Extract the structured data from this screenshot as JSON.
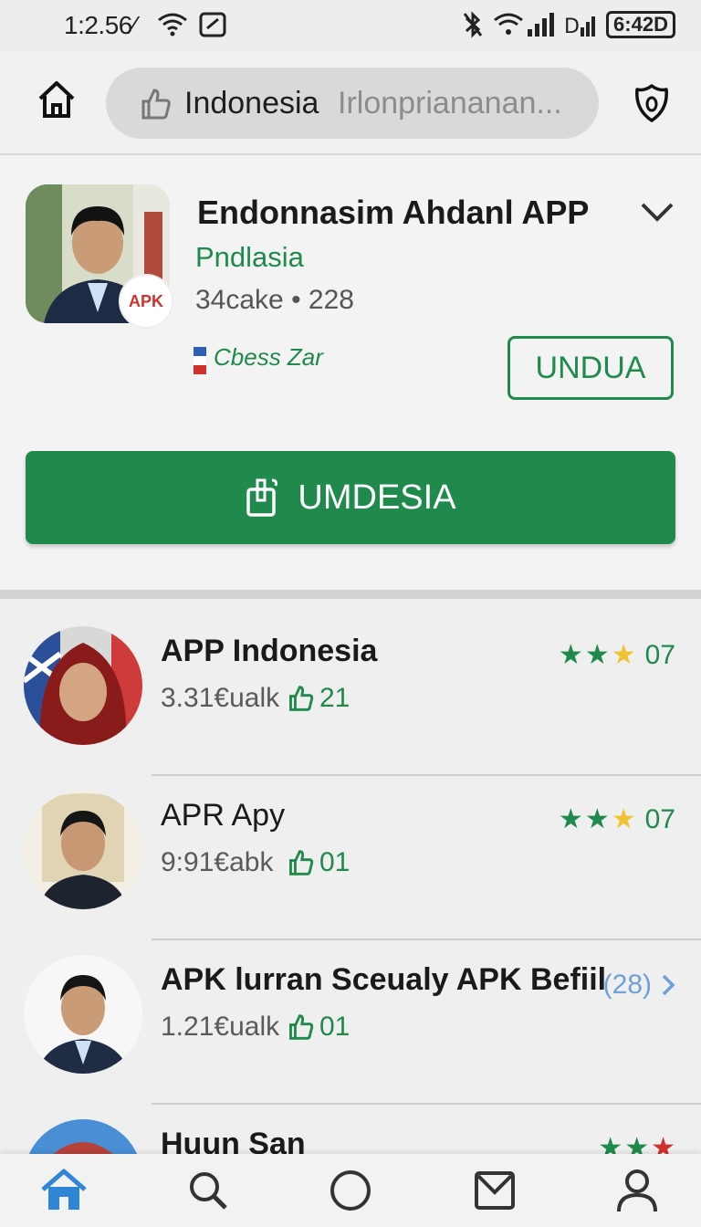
{
  "status_bar": {
    "time": "1:2.56⁄",
    "battery": "6:42D",
    "icons": [
      "wifi-icon",
      "screen-cast-icon",
      "bluetooth-off-icon",
      "signal-icon",
      "battery-icon"
    ]
  },
  "header": {
    "search_strong": "Indonesia",
    "search_faded": "Irlonpriananan...",
    "icons": [
      "home-icon",
      "thumbs-up-icon",
      "shield-icon"
    ]
  },
  "detail": {
    "title": "Endonnasim Ahdanl APP",
    "subtitle": "Pndlasia",
    "meta": "34cake • 228",
    "developer": "Cbess Zar",
    "badge": "APK",
    "outline_button": "UNDUA",
    "primary_button": "UMDESIA",
    "accent_color": "#1f8a4c"
  },
  "list": [
    {
      "title": "APP Indonesia",
      "size": "3.31€ualk",
      "likes": "21",
      "rating_text": "07",
      "stars": 3,
      "bold": true
    },
    {
      "title": "APR Apy",
      "size": "9:91€abk",
      "likes": "01",
      "rating_text": "07",
      "stars": 3,
      "bold": false
    },
    {
      "title": "APK lurran Sceualy APK Befiil",
      "size": "1.21€ualk",
      "likes": "01",
      "rating_text": "(28)",
      "stars": 0,
      "bold": true
    },
    {
      "title": "Huun San",
      "size": "",
      "likes": "",
      "rating_text": "",
      "stars": 3,
      "bold": true
    }
  ],
  "bottom_nav": [
    "home-icon",
    "search-icon",
    "circle-icon",
    "mail-icon",
    "profile-icon"
  ]
}
